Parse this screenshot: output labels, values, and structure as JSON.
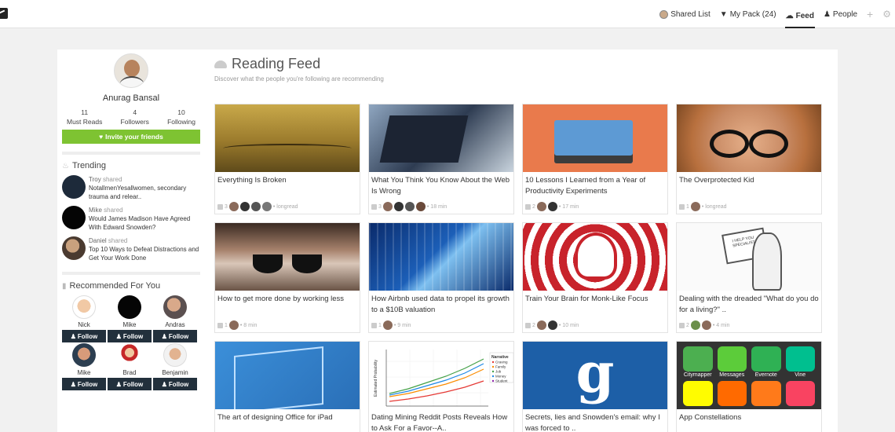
{
  "nav": {
    "items": [
      {
        "label": "Shared List",
        "icon": "avatar-icon",
        "active": false
      },
      {
        "label": "My Pack (24)",
        "icon": "backpack-icon",
        "active": false
      },
      {
        "label": "Feed",
        "icon": "feed-icon",
        "active": true
      },
      {
        "label": "People",
        "icon": "people-icon",
        "active": false
      }
    ]
  },
  "profile": {
    "name": "Anurag Bansal",
    "stats": [
      {
        "value": "11",
        "label": "Must Reads"
      },
      {
        "value": "4",
        "label": "Followers"
      },
      {
        "value": "10",
        "label": "Following"
      }
    ],
    "invite_label": "Invite your friends"
  },
  "trending": {
    "title": "Trending",
    "items": [
      {
        "user": "Troy",
        "verb": "shared",
        "text": "NotallmenYesallwomen, secondary trauma and relear.."
      },
      {
        "user": "Mike",
        "verb": "shared",
        "text": "Would James Madison Have Agreed With Edward Snowden?"
      },
      {
        "user": "Daniel",
        "verb": "shared",
        "text": "Top 10 Ways to Defeat Distractions and Get Your Work Done"
      }
    ]
  },
  "recommended": {
    "title": "Recommended For You",
    "follow_label": "Follow",
    "people": [
      {
        "name": "Nick"
      },
      {
        "name": "Mike"
      },
      {
        "name": "Andras"
      },
      {
        "name": "Mike"
      },
      {
        "name": "Brad"
      },
      {
        "name": "Benjamin"
      }
    ]
  },
  "feed": {
    "title": "Reading Feed",
    "subtitle": "Discover what the people you're following are recommending",
    "cards": [
      {
        "title": "Everything Is Broken",
        "likes": "3",
        "meta": "• longread"
      },
      {
        "title": "What You Think You Know About the Web Is Wrong",
        "likes": "3",
        "meta": "• 18 min"
      },
      {
        "title": "10 Lessons I Learned from a Year of Productivity Experiments",
        "likes": "2",
        "meta": "• 17 min"
      },
      {
        "title": "The Overprotected Kid",
        "likes": "1",
        "meta": "• longread"
      },
      {
        "title": "How to get more done by working less",
        "likes": "1",
        "meta": "• 8 min"
      },
      {
        "title": "How Airbnb used data to propel its growth to a $10B valuation",
        "likes": "1",
        "meta": "• 9 min"
      },
      {
        "title": "Train Your Brain for Monk-Like Focus",
        "likes": "2",
        "meta": "• 10 min"
      },
      {
        "title": "Dealing with the dreaded \"What do you do for a living?\" ..",
        "likes": "2",
        "meta": "• 4 min"
      },
      {
        "title": "The art of designing Office for iPad",
        "likes": "",
        "meta": ""
      },
      {
        "title": "Dating Mining Reddit Posts Reveals How to Ask For a Favor--A..",
        "likes": "",
        "meta": ""
      },
      {
        "title": "Secrets, lies and Snowden's email: why I was forced to ..",
        "likes": "",
        "meta": ""
      },
      {
        "title": "App Constellations",
        "likes": "",
        "meta": ""
      }
    ]
  },
  "chart_image": {
    "ylabel": "Estimated Probability",
    "legend_title": "Narrative",
    "legend": [
      "Craving",
      "Family",
      "Job",
      "Money",
      "Student"
    ],
    "colors": [
      "#e53935",
      "#fb8c00",
      "#43a047",
      "#1e88e5",
      "#8e24aa"
    ]
  },
  "apps_image": {
    "labels": [
      "Citymapper",
      "Messages",
      "Evernote",
      "Vine"
    ]
  },
  "note_image": {
    "text": "I HELP YOU SPECIALIST"
  },
  "google_image": {
    "letter": "g"
  }
}
